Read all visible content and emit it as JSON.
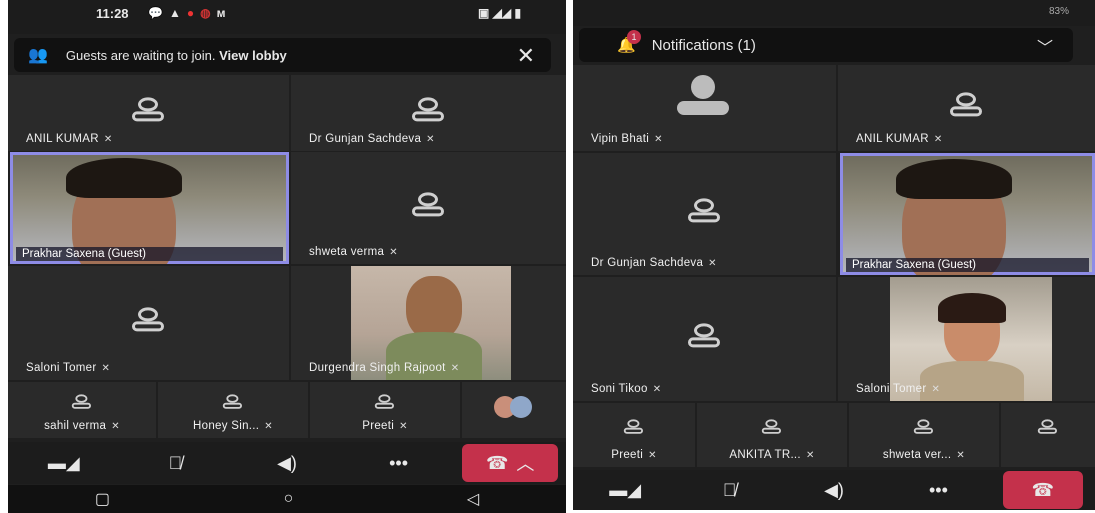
{
  "left": {
    "status": {
      "time": "11:28",
      "icons": [
        "chat-icon",
        "app-icon",
        "jio-icon",
        "app-icon",
        "maps-icon"
      ],
      "right_icons": [
        "volte-icon",
        "signal-icon",
        "battery-icon"
      ]
    },
    "banner": {
      "text": "Guests are waiting to join. ",
      "link": "View lobby"
    },
    "tiles": {
      "t1": "ANIL KUMAR",
      "t2": "Dr Gunjan Sachdeva",
      "t3": "Prakhar Saxena (Guest)",
      "t4": "shweta verma",
      "t5": "Saloni Tomer",
      "t6": "Durgendra Singh Rajpoot",
      "m1": "sahil verma",
      "m2": "Honey Sin...",
      "m3": "Preeti"
    }
  },
  "right": {
    "status": {
      "battery": "83%"
    },
    "notifications": {
      "label": "Notifications (1)",
      "badge": "1"
    },
    "tiles": {
      "t1": "Vipin Bhati",
      "t2": "ANIL KUMAR",
      "t3": "Dr Gunjan Sachdeva",
      "t4": "Prakhar Saxena (Guest)",
      "t5": "Soni Tikoo",
      "t6": "Saloni Tomer",
      "m1": "Preeti",
      "m2": "ANKITA TR...",
      "m3": "shweta ver..."
    }
  },
  "colors": {
    "accent": "#8e8ce6",
    "hangup": "#c4314b",
    "tile": "#2a2a2a"
  }
}
